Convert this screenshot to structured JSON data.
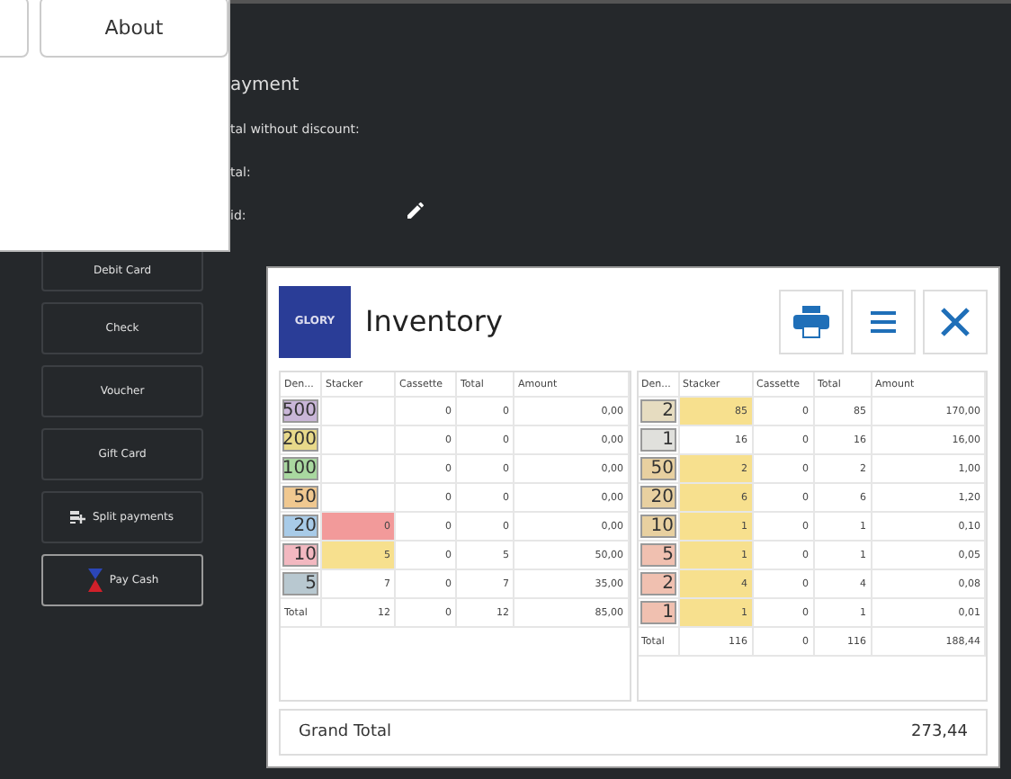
{
  "popup": {
    "buttons": [
      {
        "kind": "partial"
      },
      {
        "kind": "full",
        "label": "About"
      }
    ]
  },
  "payment": {
    "title": "ayment",
    "fields": [
      {
        "label": "tal without discount:",
        "kind": "plain"
      },
      {
        "label": "tal:",
        "kind": "plain"
      },
      {
        "label": "id:",
        "kind": "edit"
      }
    ]
  },
  "sidebar": {
    "items": [
      {
        "label": "Debit Card",
        "kind": "plain",
        "selected": false
      },
      {
        "label": "Check",
        "kind": "plain",
        "selected": false
      },
      {
        "label": "Voucher",
        "kind": "plain",
        "selected": false
      },
      {
        "label": "Gift Card",
        "kind": "plain",
        "selected": false
      },
      {
        "label": "Split payments",
        "kind": "split",
        "selected": false
      },
      {
        "label": "Pay Cash",
        "kind": "cash",
        "selected": true
      }
    ]
  },
  "dialog": {
    "logo": "GLORY",
    "title": "Inventory",
    "tables": [
      {
        "columns": [
          "Den...",
          "Stacker",
          "Cassette",
          "Total",
          "Amount"
        ],
        "rows": [
          {
            "denomination": "500",
            "color": "#c9b6d8",
            "stacker": "",
            "stacker_critical": false,
            "stacker_warning": false,
            "cassette": "0",
            "total": "0",
            "amount": "0,00"
          },
          {
            "denomination": "200",
            "color": "#e8d98a",
            "stacker": "",
            "stacker_critical": false,
            "stacker_warning": false,
            "cassette": "0",
            "total": "0",
            "amount": "0,00"
          },
          {
            "denomination": "100",
            "color": "#a9d8a0",
            "stacker": "",
            "stacker_critical": false,
            "stacker_warning": false,
            "cassette": "0",
            "total": "0",
            "amount": "0,00"
          },
          {
            "denomination": "50",
            "color": "#f0c890",
            "stacker": "",
            "stacker_critical": false,
            "stacker_warning": false,
            "cassette": "0",
            "total": "0",
            "amount": "0,00"
          },
          {
            "denomination": "20",
            "color": "#a8cbe8",
            "stacker": "0",
            "stacker_critical": true,
            "stacker_warning": false,
            "cassette": "0",
            "total": "0",
            "amount": "0,00"
          },
          {
            "denomination": "10",
            "color": "#f2b8c0",
            "stacker": "5",
            "stacker_critical": false,
            "stacker_warning": true,
            "cassette": "0",
            "total": "5",
            "amount": "50,00"
          },
          {
            "denomination": "5",
            "color": "#b8c8d0",
            "stacker": "7",
            "stacker_critical": false,
            "stacker_warning": false,
            "cassette": "0",
            "total": "7",
            "amount": "35,00"
          }
        ],
        "totals": {
          "label": "Total",
          "stacker": "12",
          "cassette": "0",
          "total": "12",
          "amount": "85,00"
        }
      },
      {
        "columns": [
          "Den...",
          "Stacker",
          "Cassette",
          "Total",
          "Amount"
        ],
        "rows": [
          {
            "denomination": "2",
            "color": "#e6dcc0",
            "stacker": "85",
            "stacker_critical": false,
            "stacker_warning": true,
            "cassette": "0",
            "total": "85",
            "amount": "170,00"
          },
          {
            "denomination": "1",
            "color": "#e0e0dc",
            "stacker": "16",
            "stacker_critical": false,
            "stacker_warning": false,
            "cassette": "0",
            "total": "16",
            "amount": "16,00"
          },
          {
            "denomination": "50",
            "color": "#e8d0a0",
            "stacker": "2",
            "stacker_critical": false,
            "stacker_warning": true,
            "cassette": "0",
            "total": "2",
            "amount": "1,00"
          },
          {
            "denomination": "20",
            "color": "#e8d0a0",
            "stacker": "6",
            "stacker_critical": false,
            "stacker_warning": true,
            "cassette": "0",
            "total": "6",
            "amount": "1,20"
          },
          {
            "denomination": "10",
            "color": "#e8d0a0",
            "stacker": "1",
            "stacker_critical": false,
            "stacker_warning": true,
            "cassette": "0",
            "total": "1",
            "amount": "0,10"
          },
          {
            "denomination": "5",
            "color": "#f0c0b0",
            "stacker": "1",
            "stacker_critical": false,
            "stacker_warning": true,
            "cassette": "0",
            "total": "1",
            "amount": "0,05"
          },
          {
            "denomination": "2",
            "color": "#f0c0b0",
            "stacker": "4",
            "stacker_critical": false,
            "stacker_warning": true,
            "cassette": "0",
            "total": "4",
            "amount": "0,08"
          },
          {
            "denomination": "1",
            "color": "#f0c0b0",
            "stacker": "1",
            "stacker_critical": false,
            "stacker_warning": true,
            "cassette": "0",
            "total": "1",
            "amount": "0,01"
          }
        ],
        "totals": {
          "label": "Total",
          "stacker": "116",
          "cassette": "0",
          "total": "116",
          "amount": "188,44"
        }
      }
    ],
    "grand_total": {
      "label": "Grand Total",
      "value": "273,44"
    }
  }
}
